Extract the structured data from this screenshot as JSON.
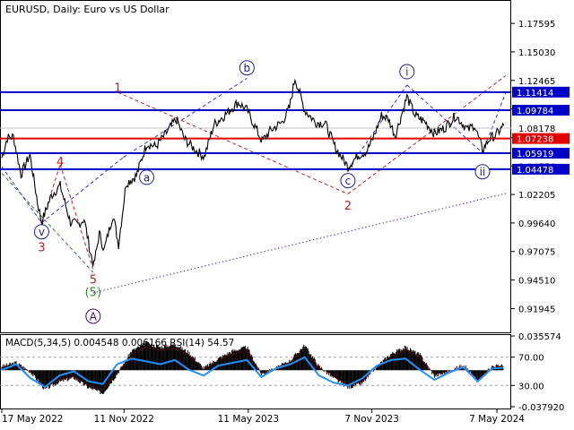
{
  "chart_data": {
    "type": "line",
    "symbol": "EURUSD",
    "timeframe": "Daily",
    "title": "EURUSD, Daily:  Euro vs US Dollar",
    "x_tick_labels": [
      "17 May 2022",
      "11 Nov 2022",
      "11 May 2023",
      "7 Nov 2023",
      "7 May 2024"
    ],
    "x_range": [
      "2022-05-17",
      "2024-05-20"
    ],
    "y_range": [
      0.898,
      1.197
    ],
    "y_tick_labels": [
      "1.17595",
      "1.15030",
      "1.12465",
      "1.09900",
      "1.07335",
      "1.04770",
      "1.02205",
      "0.99640",
      "0.97075",
      "0.94510",
      "0.91945"
    ],
    "price_series": {
      "name": "EURUSD",
      "color": "#000000",
      "x": [
        "2022-05-17",
        "2022-05-25",
        "2022-06-03",
        "2022-06-14",
        "2022-06-27",
        "2022-07-08",
        "2022-07-14",
        "2022-07-28",
        "2022-08-10",
        "2022-08-25",
        "2022-09-05",
        "2022-09-14",
        "2022-09-23",
        "2022-09-28",
        "2022-10-06",
        "2022-10-13",
        "2022-10-26",
        "2022-11-03",
        "2022-11-14",
        "2022-11-29",
        "2022-12-14",
        "2022-12-27",
        "2023-01-09",
        "2023-01-26",
        "2023-02-07",
        "2023-02-23",
        "2023-03-08",
        "2023-03-22",
        "2023-04-06",
        "2023-04-26",
        "2023-05-09",
        "2023-05-31",
        "2023-06-13",
        "2023-06-29",
        "2023-07-10",
        "2023-07-18",
        "2023-08-01",
        "2023-08-17",
        "2023-08-31",
        "2023-09-14",
        "2023-10-03",
        "2023-10-17",
        "2023-10-30",
        "2023-11-07",
        "2023-11-21",
        "2023-12-01",
        "2023-12-11",
        "2023-12-28",
        "2024-01-09",
        "2024-01-24",
        "2024-02-06",
        "2024-02-21",
        "2024-03-08",
        "2024-03-26",
        "2024-04-04",
        "2024-04-16",
        "2024-04-26",
        "2024-05-06",
        "2024-05-17"
      ],
      "values": [
        1.055,
        1.073,
        1.074,
        1.04,
        1.058,
        1.015,
        0.997,
        1.021,
        1.03,
        0.997,
        0.995,
        1.0,
        0.97,
        0.958,
        0.987,
        0.972,
        1.004,
        0.977,
        1.032,
        1.039,
        1.068,
        1.065,
        1.075,
        1.09,
        1.072,
        1.062,
        1.056,
        1.085,
        1.093,
        1.105,
        1.098,
        1.07,
        1.08,
        1.087,
        1.1,
        1.127,
        1.098,
        1.087,
        1.086,
        1.065,
        1.047,
        1.057,
        1.061,
        1.07,
        1.093,
        1.09,
        1.075,
        1.11,
        1.093,
        1.087,
        1.077,
        1.082,
        1.093,
        1.08,
        1.085,
        1.062,
        1.072,
        1.076,
        1.084
      ]
    },
    "current_price": "1.08178",
    "horizontal_levels": [
      {
        "label": "1.11414",
        "value": 1.11414,
        "color": "#0000c8"
      },
      {
        "label": "1.09784",
        "value": 1.09784,
        "color": "#0000c8"
      },
      {
        "label": "1.07238",
        "value": 1.07238,
        "color": "#e00000"
      },
      {
        "label": "1.05919",
        "value": 1.05919,
        "color": "#0000c8"
      },
      {
        "label": "1.04478",
        "value": 1.04478,
        "color": "#0000c8"
      }
    ],
    "wave_labels": [
      {
        "text": "1",
        "x": "2022-11-02",
        "y": 1.1185,
        "style": "plain",
        "color": "#b22222"
      },
      {
        "text": "2",
        "x": "2023-10-03",
        "y": 1.0125,
        "style": "plain",
        "color": "#b22222"
      },
      {
        "text": "3",
        "x": "2022-07-14",
        "y": 0.975,
        "style": "plain",
        "color": "#b22222"
      },
      {
        "text": "4",
        "x": "2022-08-10",
        "y": 1.052,
        "style": "plain",
        "color": "#b22222"
      },
      {
        "text": "5",
        "x": "2022-09-27",
        "y": 0.946,
        "style": "plain",
        "color": "#b22222"
      },
      {
        "text": "(5)",
        "x": "2022-09-27",
        "y": 0.9345,
        "style": "plain",
        "color": "#2e8b2e"
      },
      {
        "text": "A",
        "x": "2022-09-27",
        "y": 0.9125,
        "style": "circle",
        "color": "#3c1464"
      },
      {
        "text": "v",
        "x": "2022-07-14",
        "y": 0.9885,
        "style": "circle",
        "color": "#1e1e96"
      },
      {
        "text": "a",
        "x": "2022-12-14",
        "y": 1.0375,
        "style": "circle",
        "color": "#1e1e96"
      },
      {
        "text": "b",
        "x": "2023-05-09",
        "y": 1.136,
        "style": "circle",
        "color": "#1e1e96"
      },
      {
        "text": "c",
        "x": "2023-10-03",
        "y": 1.0345,
        "style": "circle",
        "color": "#1e1e96"
      },
      {
        "text": "i",
        "x": "2023-12-28",
        "y": 1.1325,
        "style": "circle",
        "color": "#1e1e96"
      },
      {
        "text": "ii",
        "x": "2024-04-16",
        "y": 1.0425,
        "style": "circle",
        "color": "#1e1e96"
      }
    ],
    "trend_lines": [
      {
        "from": {
          "x": "2022-09-27",
          "y": 0.9335
        },
        "to": {
          "x": "2024-05-20",
          "y": 1.023
        },
        "color": "#5a28a0",
        "dash": "dotted"
      },
      {
        "from": {
          "x": "2022-05-17",
          "y": 1.047
        },
        "to": {
          "x": "2022-07-14",
          "y": 0.9965
        },
        "color": "#3232c8",
        "dash": "dashed"
      },
      {
        "from": {
          "x": "2022-07-14",
          "y": 0.9965
        },
        "to": {
          "x": "2022-11-10",
          "y": 1.0555
        },
        "color": "#3232c8",
        "dash": "dashed"
      },
      {
        "from": {
          "x": "2022-11-10",
          "y": 1.0555
        },
        "to": {
          "x": "2023-05-09",
          "y": 1.1265
        },
        "color": "#3232c8",
        "dash": "dashed"
      },
      {
        "from": {
          "x": "2023-10-03",
          "y": 1.0447
        },
        "to": {
          "x": "2023-12-28",
          "y": 1.1205
        },
        "color": "#3232c8",
        "dash": "dashed"
      },
      {
        "from": {
          "x": "2023-12-28",
          "y": 1.1205
        },
        "to": {
          "x": "2024-04-16",
          "y": 1.0595
        },
        "color": "#3232c8",
        "dash": "dashed"
      },
      {
        "from": {
          "x": "2024-04-16",
          "y": 1.0595
        },
        "to": {
          "x": "2024-05-20",
          "y": 1.114
        },
        "color": "#3232c8",
        "dash": "dashed"
      },
      {
        "from": {
          "x": "2022-05-17",
          "y": 1.041
        },
        "to": {
          "x": "2022-09-27",
          "y": 0.952
        },
        "color": "#3a7a3a",
        "dash": "dashed"
      },
      {
        "from": {
          "x": "2022-07-14",
          "y": 0.9965
        },
        "to": {
          "x": "2022-08-10",
          "y": 1.049
        },
        "color": "#b22222",
        "dash": "dashed"
      },
      {
        "from": {
          "x": "2022-08-10",
          "y": 1.049
        },
        "to": {
          "x": "2022-09-27",
          "y": 0.955
        },
        "color": "#b22222",
        "dash": "dashed"
      },
      {
        "from": {
          "x": "2022-11-02",
          "y": 1.114
        },
        "to": {
          "x": "2023-10-03",
          "y": 1.0225
        },
        "color": "#b22222",
        "dash": "dashed"
      },
      {
        "from": {
          "x": "2023-10-03",
          "y": 1.0225
        },
        "to": {
          "x": "2024-05-20",
          "y": 1.129
        },
        "color": "#b22222",
        "dash": "dashed"
      }
    ],
    "indicator": {
      "label": "MACD(5,34,5) 0.004548 0.006166 RSI(14) 54.57",
      "y_tick_labels": [
        "0.035574",
        "70.00",
        "30.00",
        "-0.037920"
      ],
      "level_70": 70,
      "level_30": 30,
      "macd_range": [
        -0.0379,
        0.0356
      ],
      "rsi_range": [
        0,
        100
      ],
      "macd_x": [
        "2022-05-17",
        "2022-06-07",
        "2022-06-28",
        "2022-07-19",
        "2022-08-09",
        "2022-08-30",
        "2022-09-20",
        "2022-10-11",
        "2022-11-01",
        "2022-11-22",
        "2022-12-13",
        "2023-01-03",
        "2023-01-24",
        "2023-02-14",
        "2023-03-07",
        "2023-03-28",
        "2023-04-18",
        "2023-05-09",
        "2023-05-30",
        "2023-06-20",
        "2023-07-11",
        "2023-08-01",
        "2023-08-22",
        "2023-09-12",
        "2023-10-03",
        "2023-10-24",
        "2023-11-14",
        "2023-12-05",
        "2023-12-26",
        "2024-01-16",
        "2024-02-06",
        "2024-02-27",
        "2024-03-19",
        "2024-04-09",
        "2024-04-30",
        "2024-05-17"
      ],
      "macd_values": [
        0.004,
        0.008,
        -0.002,
        -0.02,
        -0.012,
        -0.008,
        -0.018,
        -0.024,
        -0.004,
        0.02,
        0.028,
        0.024,
        0.027,
        0.018,
        0.002,
        0.012,
        0.02,
        0.024,
        -0.004,
        0.002,
        0.01,
        0.026,
        0.004,
        -0.008,
        -0.018,
        -0.014,
        0.004,
        0.017,
        0.024,
        0.016,
        -0.006,
        -0.002,
        0.006,
        -0.012,
        0.004,
        0.005
      ],
      "rsi_values": [
        52,
        60,
        40,
        28,
        44,
        50,
        36,
        32,
        60,
        68,
        64,
        60,
        66,
        52,
        44,
        58,
        62,
        66,
        42,
        54,
        60,
        70,
        44,
        34,
        30,
        40,
        58,
        66,
        68,
        52,
        38,
        48,
        56,
        36,
        54,
        55
      ]
    }
  }
}
